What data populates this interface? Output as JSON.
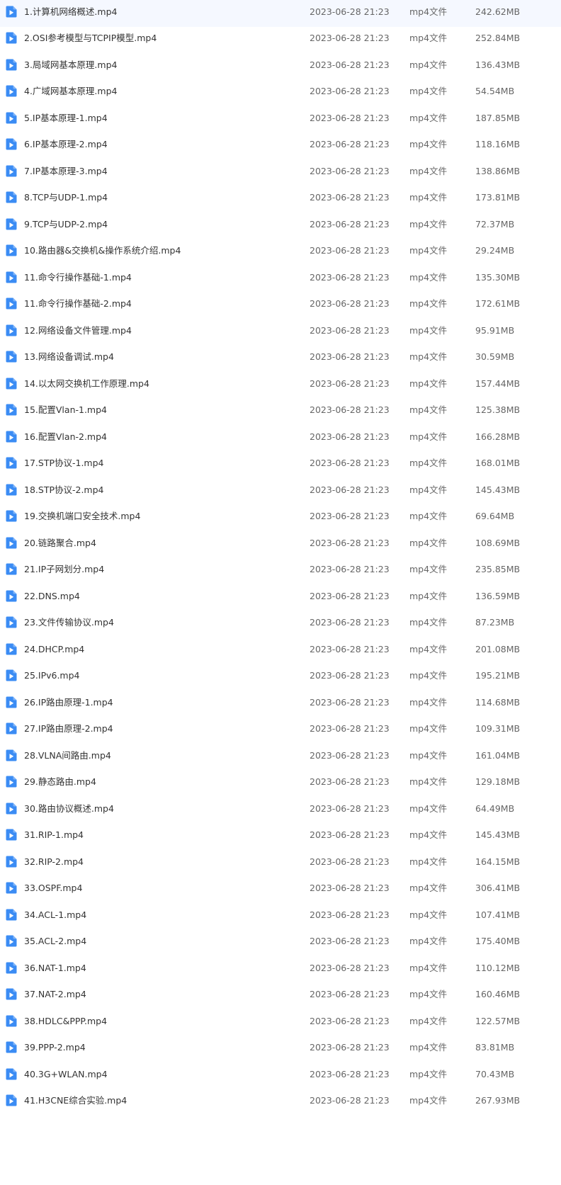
{
  "accent_color": "#3b8cf4",
  "file_icon": "video-file-icon",
  "files": [
    {
      "name": "1.计算机网络概述.mp4",
      "date": "2023-06-28 21:23",
      "type": "mp4文件",
      "size": "242.62MB"
    },
    {
      "name": "2.OSI参考模型与TCPIP模型.mp4",
      "date": "2023-06-28 21:23",
      "type": "mp4文件",
      "size": "252.84MB"
    },
    {
      "name": "3.局域网基本原理.mp4",
      "date": "2023-06-28 21:23",
      "type": "mp4文件",
      "size": "136.43MB"
    },
    {
      "name": "4.广域网基本原理.mp4",
      "date": "2023-06-28 21:23",
      "type": "mp4文件",
      "size": "54.54MB"
    },
    {
      "name": "5.IP基本原理-1.mp4",
      "date": "2023-06-28 21:23",
      "type": "mp4文件",
      "size": "187.85MB"
    },
    {
      "name": "6.IP基本原理-2.mp4",
      "date": "2023-06-28 21:23",
      "type": "mp4文件",
      "size": "118.16MB"
    },
    {
      "name": "7.IP基本原理-3.mp4",
      "date": "2023-06-28 21:23",
      "type": "mp4文件",
      "size": "138.86MB"
    },
    {
      "name": "8.TCP与UDP-1.mp4",
      "date": "2023-06-28 21:23",
      "type": "mp4文件",
      "size": "173.81MB"
    },
    {
      "name": "9.TCP与UDP-2.mp4",
      "date": "2023-06-28 21:23",
      "type": "mp4文件",
      "size": "72.37MB"
    },
    {
      "name": "10.路由器&交换机&操作系统介绍.mp4",
      "date": "2023-06-28 21:23",
      "type": "mp4文件",
      "size": "29.24MB"
    },
    {
      "name": "11.命令行操作基础-1.mp4",
      "date": "2023-06-28 21:23",
      "type": "mp4文件",
      "size": "135.30MB"
    },
    {
      "name": "11.命令行操作基础-2.mp4",
      "date": "2023-06-28 21:23",
      "type": "mp4文件",
      "size": "172.61MB"
    },
    {
      "name": "12.网络设备文件管理.mp4",
      "date": "2023-06-28 21:23",
      "type": "mp4文件",
      "size": "95.91MB"
    },
    {
      "name": "13.网络设备调试.mp4",
      "date": "2023-06-28 21:23",
      "type": "mp4文件",
      "size": "30.59MB"
    },
    {
      "name": "14.以太网交换机工作原理.mp4",
      "date": "2023-06-28 21:23",
      "type": "mp4文件",
      "size": "157.44MB"
    },
    {
      "name": "15.配置Vlan-1.mp4",
      "date": "2023-06-28 21:23",
      "type": "mp4文件",
      "size": "125.38MB"
    },
    {
      "name": "16.配置Vlan-2.mp4",
      "date": "2023-06-28 21:23",
      "type": "mp4文件",
      "size": "166.28MB"
    },
    {
      "name": "17.STP协议-1.mp4",
      "date": "2023-06-28 21:23",
      "type": "mp4文件",
      "size": "168.01MB"
    },
    {
      "name": "18.STP协议-2.mp4",
      "date": "2023-06-28 21:23",
      "type": "mp4文件",
      "size": "145.43MB"
    },
    {
      "name": "19.交换机端口安全技术.mp4",
      "date": "2023-06-28 21:23",
      "type": "mp4文件",
      "size": "69.64MB"
    },
    {
      "name": "20.链路聚合.mp4",
      "date": "2023-06-28 21:23",
      "type": "mp4文件",
      "size": "108.69MB"
    },
    {
      "name": "21.IP子网划分.mp4",
      "date": "2023-06-28 21:23",
      "type": "mp4文件",
      "size": "235.85MB"
    },
    {
      "name": "22.DNS.mp4",
      "date": "2023-06-28 21:23",
      "type": "mp4文件",
      "size": "136.59MB"
    },
    {
      "name": "23.文件传输协议.mp4",
      "date": "2023-06-28 21:23",
      "type": "mp4文件",
      "size": "87.23MB"
    },
    {
      "name": "24.DHCP.mp4",
      "date": "2023-06-28 21:23",
      "type": "mp4文件",
      "size": "201.08MB"
    },
    {
      "name": "25.IPv6.mp4",
      "date": "2023-06-28 21:23",
      "type": "mp4文件",
      "size": "195.21MB"
    },
    {
      "name": "26.IP路由原理-1.mp4",
      "date": "2023-06-28 21:23",
      "type": "mp4文件",
      "size": "114.68MB"
    },
    {
      "name": "27.IP路由原理-2.mp4",
      "date": "2023-06-28 21:23",
      "type": "mp4文件",
      "size": "109.31MB"
    },
    {
      "name": "28.VLNA间路由.mp4",
      "date": "2023-06-28 21:23",
      "type": "mp4文件",
      "size": "161.04MB"
    },
    {
      "name": "29.静态路由.mp4",
      "date": "2023-06-28 21:23",
      "type": "mp4文件",
      "size": "129.18MB"
    },
    {
      "name": "30.路由协议概述.mp4",
      "date": "2023-06-28 21:23",
      "type": "mp4文件",
      "size": "64.49MB"
    },
    {
      "name": "31.RIP-1.mp4",
      "date": "2023-06-28 21:23",
      "type": "mp4文件",
      "size": "145.43MB"
    },
    {
      "name": "32.RIP-2.mp4",
      "date": "2023-06-28 21:23",
      "type": "mp4文件",
      "size": "164.15MB"
    },
    {
      "name": "33.OSPF.mp4",
      "date": "2023-06-28 21:23",
      "type": "mp4文件",
      "size": "306.41MB"
    },
    {
      "name": "34.ACL-1.mp4",
      "date": "2023-06-28 21:23",
      "type": "mp4文件",
      "size": "107.41MB"
    },
    {
      "name": "35.ACL-2.mp4",
      "date": "2023-06-28 21:23",
      "type": "mp4文件",
      "size": "175.40MB"
    },
    {
      "name": "36.NAT-1.mp4",
      "date": "2023-06-28 21:23",
      "type": "mp4文件",
      "size": "110.12MB"
    },
    {
      "name": "37.NAT-2.mp4",
      "date": "2023-06-28 21:23",
      "type": "mp4文件",
      "size": "160.46MB"
    },
    {
      "name": "38.HDLC&PPP.mp4",
      "date": "2023-06-28 21:23",
      "type": "mp4文件",
      "size": "122.57MB"
    },
    {
      "name": "39.PPP-2.mp4",
      "date": "2023-06-28 21:23",
      "type": "mp4文件",
      "size": "83.81MB"
    },
    {
      "name": "40.3G+WLAN.mp4",
      "date": "2023-06-28 21:23",
      "type": "mp4文件",
      "size": "70.43MB"
    },
    {
      "name": "41.H3CNE综合实验.mp4",
      "date": "2023-06-28 21:23",
      "type": "mp4文件",
      "size": "267.93MB"
    }
  ]
}
